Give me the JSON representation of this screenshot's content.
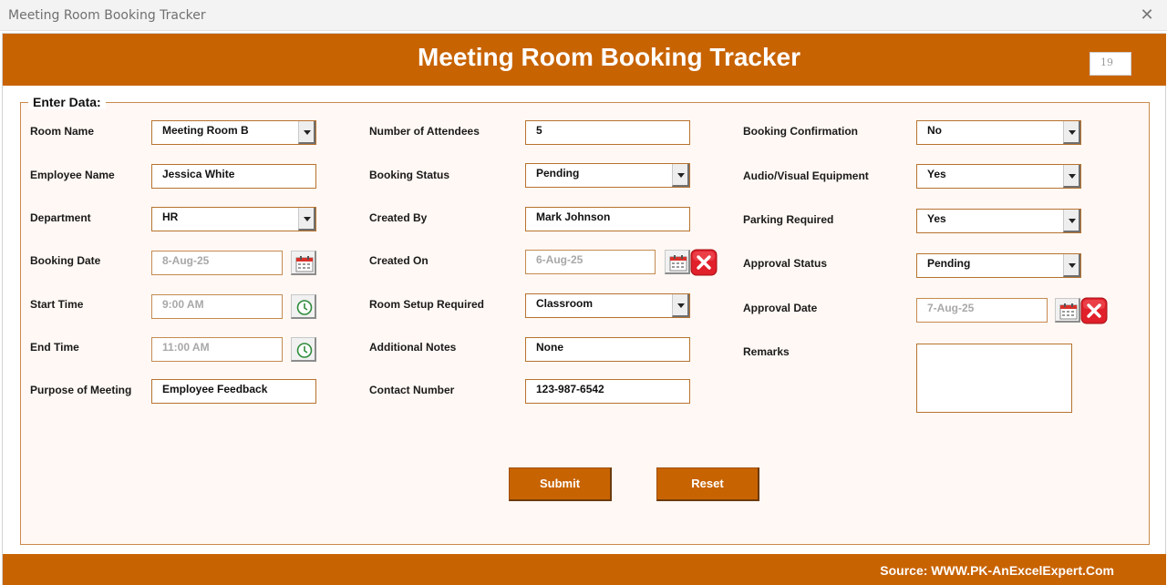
{
  "window": {
    "title": "Meeting Room Booking Tracker",
    "close_glyph": "✕"
  },
  "header": {
    "title": "Meeting Room Booking Tracker",
    "record_number": "19"
  },
  "form": {
    "legend": "Enter Data:",
    "room_name": {
      "label": "Room Name",
      "value": "Meeting Room B"
    },
    "employee_name": {
      "label": "Employee Name",
      "value": "Jessica White"
    },
    "department": {
      "label": "Department",
      "value": "HR"
    },
    "booking_date": {
      "label": "Booking Date",
      "value": "8-Aug-25"
    },
    "start_time": {
      "label": "Start Time",
      "value": "9:00 AM"
    },
    "end_time": {
      "label": "End Time",
      "value": "11:00 AM"
    },
    "purpose": {
      "label": "Purpose of Meeting",
      "value": "Employee Feedback"
    },
    "attendees": {
      "label": "Number of Attendees",
      "value": "5"
    },
    "booking_status": {
      "label": "Booking Status",
      "value": "Pending"
    },
    "created_by": {
      "label": "Created By",
      "value": "Mark Johnson"
    },
    "created_on": {
      "label": "Created On",
      "value": "6-Aug-25"
    },
    "room_setup": {
      "label": "Room Setup Required",
      "value": "Classroom"
    },
    "notes": {
      "label": "Additional Notes",
      "value": "None"
    },
    "contact": {
      "label": "Contact Number",
      "value": "123-987-6542"
    },
    "confirmation": {
      "label": "Booking Confirmation",
      "value": "No"
    },
    "av_equipment": {
      "label": "Audio/Visual Equipment",
      "value": "Yes"
    },
    "parking": {
      "label": "Parking Required",
      "value": "Yes"
    },
    "approval_status": {
      "label": "Approval Status",
      "value": "Pending"
    },
    "approval_date": {
      "label": "Approval Date",
      "value": "7-Aug-25"
    },
    "remarks": {
      "label": "Remarks",
      "value": ""
    }
  },
  "buttons": {
    "submit": "Submit",
    "reset": "Reset"
  },
  "footer": {
    "source": "Source: WWW.PK-AnExcelExpert.Com"
  },
  "colors": {
    "accent": "#c86302",
    "panel_bg": "#fff8f4",
    "panel_border": "#c98a4c",
    "clear_red": "#e0202a"
  }
}
